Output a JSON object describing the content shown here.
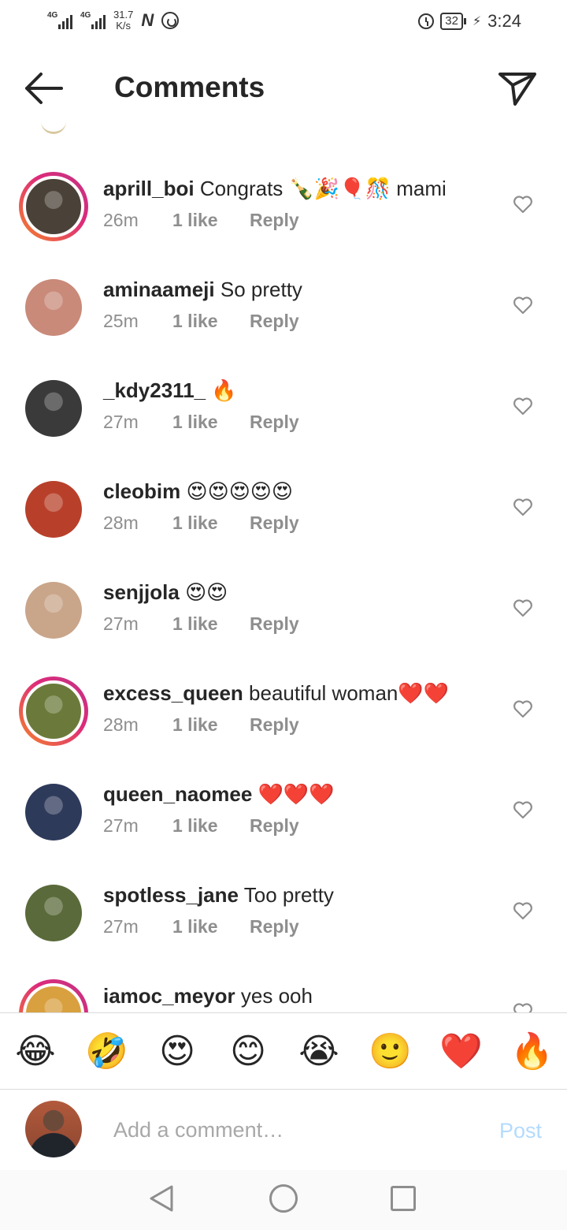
{
  "status_bar": {
    "net1": "4G",
    "net2": "4G",
    "speed_value": "31.7",
    "speed_unit": "K/s",
    "notif_letter": "N",
    "battery": "32",
    "time": "3:24"
  },
  "header": {
    "title": "Comments"
  },
  "comments": [
    {
      "username": "aprill_boi",
      "text": "Congrats 🍾🎉🎈🎊 mami",
      "time": "26m",
      "likes": "1 like",
      "reply": "Reply",
      "story_ring": true,
      "avatar_color": "#4a4238"
    },
    {
      "username": "aminaameji",
      "text": "So pretty",
      "time": "25m",
      "likes": "1 like",
      "reply": "Reply",
      "story_ring": false,
      "avatar_color": "#c98a7a"
    },
    {
      "username": "_kdy2311_",
      "text": "🔥",
      "time": "27m",
      "likes": "1 like",
      "reply": "Reply",
      "story_ring": false,
      "avatar_color": "#3a3a3a"
    },
    {
      "username": "cleobim",
      "text": "😍😍😍😍😍",
      "time": "28m",
      "likes": "1 like",
      "reply": "Reply",
      "story_ring": false,
      "avatar_color": "#b8402a"
    },
    {
      "username": "senjjola",
      "text": "😍😍",
      "time": "27m",
      "likes": "1 like",
      "reply": "Reply",
      "story_ring": false,
      "avatar_color": "#c9a58a"
    },
    {
      "username": "excess_queen",
      "text": "beautiful woman❤️❤️",
      "time": "28m",
      "likes": "1 like",
      "reply": "Reply",
      "story_ring": true,
      "avatar_color": "#6b7a3a"
    },
    {
      "username": "queen_naomee",
      "text": "❤️❤️❤️",
      "time": "27m",
      "likes": "1 like",
      "reply": "Reply",
      "story_ring": false,
      "avatar_color": "#2e3a5a"
    },
    {
      "username": "spotless_jane",
      "text": "Too pretty",
      "time": "27m",
      "likes": "1 like",
      "reply": "Reply",
      "story_ring": false,
      "avatar_color": "#5a6a3a"
    },
    {
      "username": "iamoc_meyor",
      "text": "yes ooh",
      "time": "",
      "likes": "",
      "reply": "",
      "story_ring": true,
      "avatar_color": "#d9a040"
    }
  ],
  "emoji_bar": [
    "😂",
    "🤣",
    "😍",
    "😊",
    "😭",
    "🙂",
    "❤️",
    "🔥"
  ],
  "composer": {
    "placeholder": "Add a comment…",
    "post_label": "Post"
  },
  "colors": {
    "like_gray": "#8e8e8e",
    "post_disabled": "#b3dbff",
    "ring_start": "#f58529",
    "ring_end": "#c13584"
  }
}
